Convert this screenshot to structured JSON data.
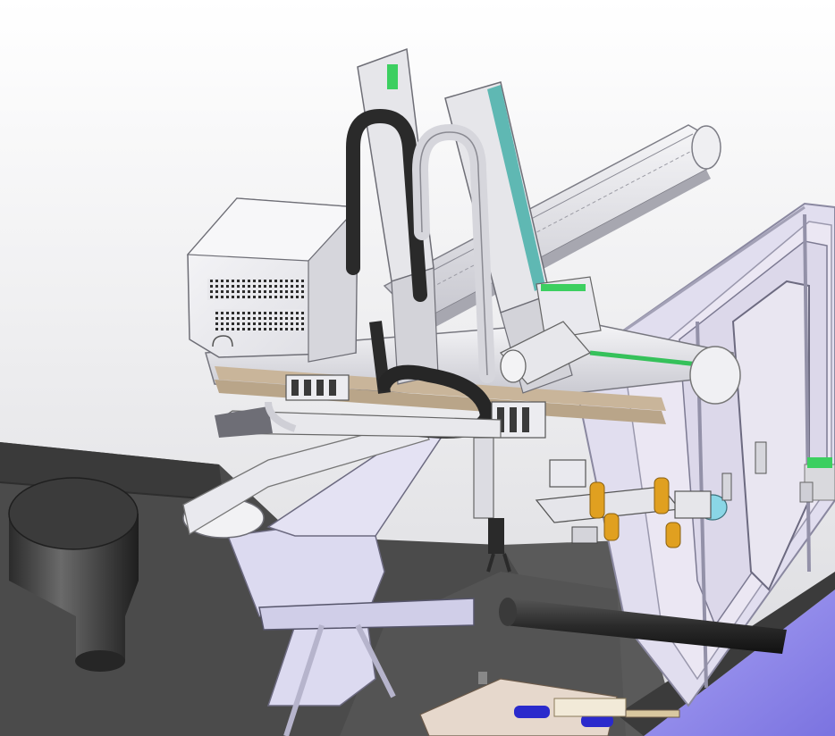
{
  "scene": {
    "colors": {
      "background_top": "#ffffff",
      "background_bottom": "#d9d9de",
      "floor_dark": "#4a4a4a",
      "floor_mid": "#5c5c5c",
      "frame_lavender": "#d8d6ec",
      "frame_panel": "#ece8f2",
      "metal_light": "#e6e6ea",
      "metal_mid": "#bdbdc4",
      "cable_black": "#2a2a2a",
      "accent_green": "#35c15a",
      "accent_teal": "#5fb8b3",
      "accent_blue": "#2a2acc",
      "accent_gold": "#e0a020",
      "accent_cyan": "#8ad6e6",
      "purple_base": "#8f88e8",
      "tan_layers": "#c9b59a"
    },
    "components": [
      "gantry-robot",
      "controller-cabinet",
      "x-axis-beam",
      "z-axis-column-left",
      "z-axis-column-right",
      "cable-carrier-left",
      "cable-carrier-right",
      "cross-beam",
      "valve-manifold",
      "gripper-end-effector",
      "support-pedestal",
      "hopper",
      "enclosure-frame",
      "mold-plate",
      "feed-pipe"
    ]
  }
}
